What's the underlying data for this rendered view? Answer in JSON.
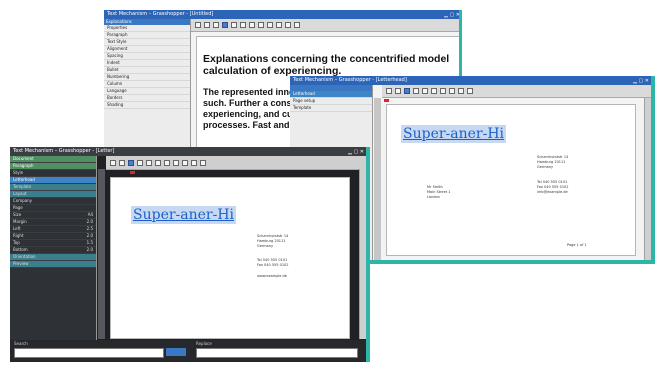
{
  "back_window": {
    "title": "Text Mechanism – Grasshopper - [Untitled]",
    "panel_header": "Explanations",
    "panel_items": [
      "Properties",
      "Paragraph",
      "Text Style",
      "Alignment",
      "Spacing",
      "Indent",
      "Bullet",
      "Numbering",
      "Column",
      "Language",
      "Borders",
      "Shading"
    ],
    "doc_heading": "Explanations concerning the concentrified model calculation of experiencing.",
    "doc_body": "The represented inner trade, therefore, and all interests in such. Further a consequent developments, which creates experiencing, and customer concepts, which are processes. Fast and forward"
  },
  "mid_window": {
    "title": "Text Mechanism – Grasshopper - [Letterhead]",
    "panel_items": [
      "Letterhead",
      "Page setup",
      "Template"
    ],
    "brand_text": "Super-aner-Hi",
    "address_block": [
      "Scharnhorststr 14",
      "Hamburg 20111",
      "Germany"
    ],
    "contact_block": [
      "Tel 040 555 0101",
      "Fax 040 555 0102",
      "info@example.de"
    ],
    "recipient_block": [
      "Mr Smith",
      "Main Street 1",
      "London"
    ],
    "footer_text": "Page 1 of 1"
  },
  "front_window": {
    "title": "Text Mechanism – Grasshopper - [Letter]",
    "panel_items": [
      {
        "label": "Document",
        "value": ""
      },
      {
        "label": "Paragraph",
        "value": ""
      },
      {
        "label": "Style",
        "value": ""
      },
      {
        "label": "Letterhead",
        "value": ""
      },
      {
        "label": "Template",
        "value": ""
      },
      {
        "label": "Layout",
        "value": ""
      },
      {
        "label": "Company",
        "value": ""
      },
      {
        "label": "Page",
        "value": ""
      },
      {
        "label": "Size",
        "value": "A4"
      },
      {
        "label": "Margin",
        "value": "2.0"
      },
      {
        "label": "Left",
        "value": "2.5"
      },
      {
        "label": "Right",
        "value": "2.0"
      },
      {
        "label": "Top",
        "value": "1.5"
      },
      {
        "label": "Bottom",
        "value": "2.0"
      },
      {
        "label": "Orientation",
        "value": ""
      },
      {
        "label": "Preview",
        "value": ""
      }
    ],
    "brand_text": "Super-aner-Hi",
    "address_block": [
      "Scharnhorststr 14",
      "Hamburg 20111",
      "Germany"
    ],
    "contact_block": [
      "Tel 040 555 0101",
      "Fax 040 555 0102"
    ],
    "footer_line": "www.example.de",
    "bottom_left_label": "Search",
    "bottom_right_label": "Replace"
  },
  "colors": {
    "accent_teal": "#2bb6a8",
    "title_blue": "#2c64b8",
    "brand_blue": "#1c5fc8"
  }
}
